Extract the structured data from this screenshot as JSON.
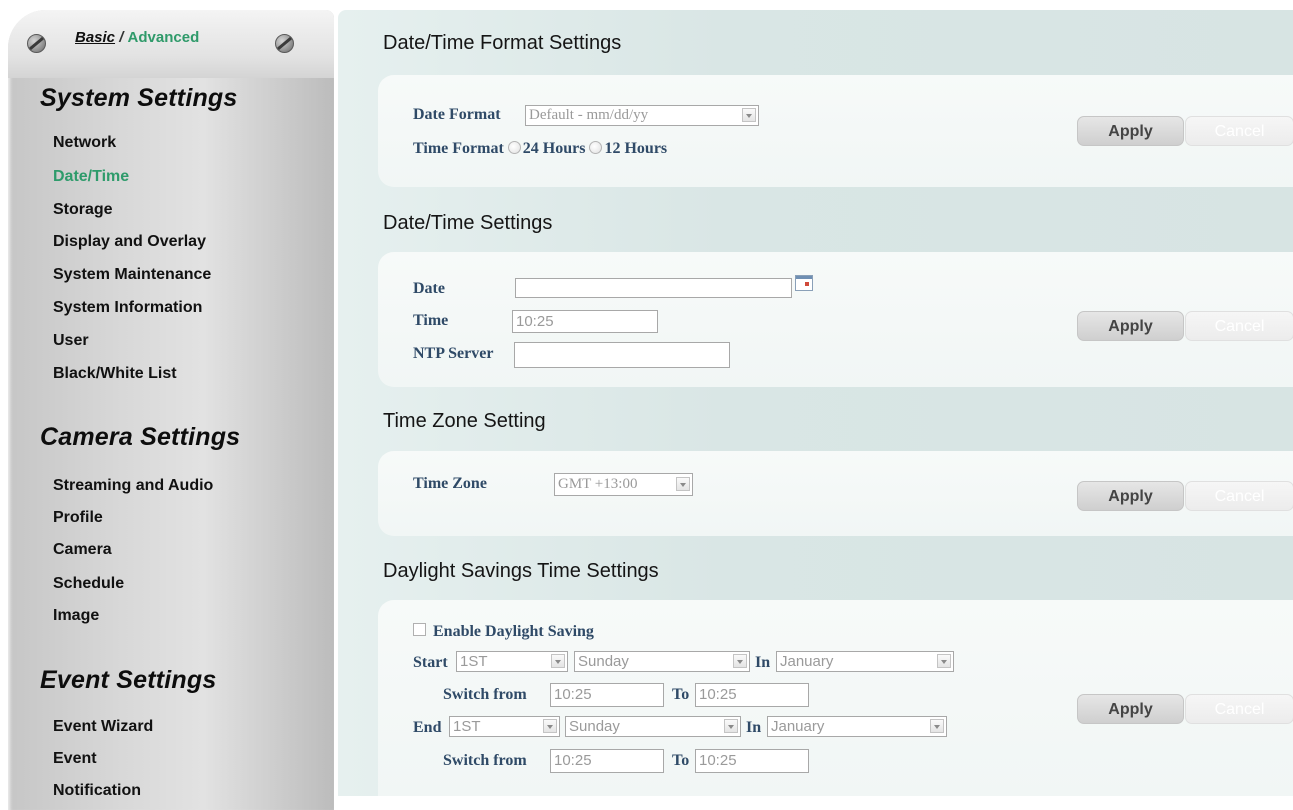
{
  "sidebar": {
    "mode": {
      "basic": "Basic",
      "separator": "/",
      "advanced": "Advanced"
    },
    "system_title": "System Settings",
    "system_items": [
      "Network",
      "Date/Time",
      "Storage",
      "Display and Overlay",
      "System Maintenance",
      "System Information",
      "User",
      "Black/White List"
    ],
    "active_item": "Date/Time",
    "camera_title": "Camera Settings",
    "camera_items": [
      "Streaming and Audio",
      "Profile",
      "Camera",
      "Schedule",
      "Image"
    ],
    "event_title": "Event Settings",
    "event_items": [
      "Event Wizard",
      "Event",
      "Notification"
    ]
  },
  "format": {
    "heading": "Date/Time Format Settings",
    "date_format_label": "Date Format",
    "date_format_value": "Default - mm/dd/yy",
    "time_format_label": "Time Format",
    "opt_24": "24 Hours",
    "opt_12": "12 Hours"
  },
  "datetime": {
    "heading": "Date/Time Settings",
    "date_label": "Date",
    "date_value": "",
    "time_label": "Time",
    "time_value": "10:25",
    "ntp_label": "NTP Server",
    "ntp_value": ""
  },
  "timezone": {
    "heading": "Time Zone Setting",
    "label": "Time Zone",
    "value": "GMT +13:00"
  },
  "dst": {
    "heading": "Daylight Savings Time Settings",
    "enable_label": "Enable Daylight Saving",
    "start_label": "Start",
    "end_label": "End",
    "in_label": "In",
    "switch_from_label": "Switch from",
    "to_label": "To",
    "start_week": "1ST",
    "start_day": "Sunday",
    "start_month": "January",
    "start_from": "10:25",
    "start_to": "10:25",
    "end_week": "1ST",
    "end_day": "Sunday",
    "end_month": "January",
    "end_from": "10:25",
    "end_to": "10:25"
  },
  "buttons": {
    "apply": "Apply",
    "cancel": "Cancel"
  },
  "colors": {
    "active_nav": "#2e9b6b",
    "label": "#2f4a67",
    "main_bg": "#d9e6e5"
  }
}
